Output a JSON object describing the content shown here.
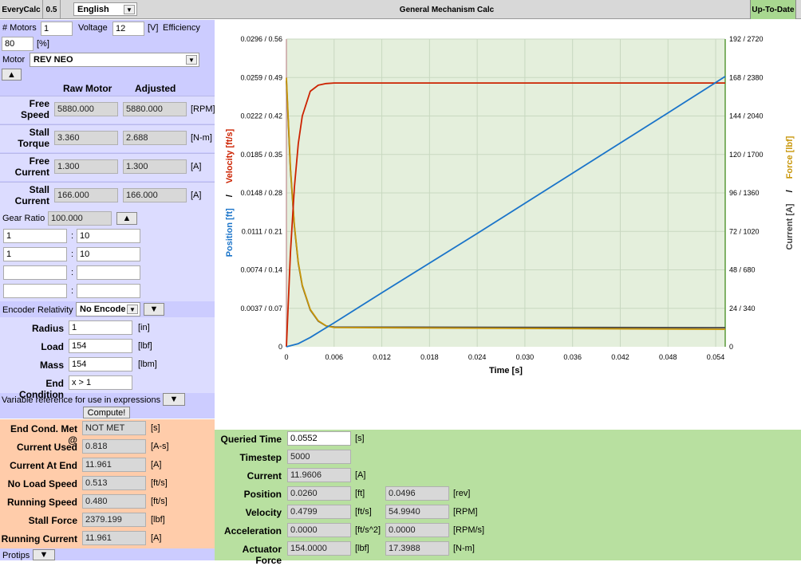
{
  "topbar": {
    "app_name": "EveryCalc",
    "version": "0.5",
    "language": "English",
    "title": "General Mechanism Calc",
    "status": "Up-To-Date"
  },
  "inputs": {
    "motors_label": "# Motors",
    "motors_value": "1",
    "voltage_label": "Voltage",
    "voltage_value": "12",
    "voltage_unit": "[V]",
    "efficiency_label": "Efficiency",
    "efficiency_value": "80",
    "efficiency_unit": "[%]",
    "motor_label": "Motor",
    "motor_value": "REV NEO",
    "collapse_glyph": "▲"
  },
  "motor_table": {
    "col_raw": "Raw Motor",
    "col_adjusted": "Adjusted",
    "rows": [
      {
        "label1": "Free",
        "label2": "Speed",
        "raw": "5880.000",
        "adjusted": "5880.000",
        "unit": "[RPM]"
      },
      {
        "label1": "Stall",
        "label2": "Torque",
        "raw": "3.360",
        "adjusted": "2.688",
        "unit": "[N-m]"
      },
      {
        "label1": "Free",
        "label2": "Current",
        "raw": "1.300",
        "adjusted": "1.300",
        "unit": "[A]"
      },
      {
        "label1": "Stall",
        "label2": "Current",
        "raw": "166.000",
        "adjusted": "166.000",
        "unit": "[A]"
      }
    ]
  },
  "gearing": {
    "label": "Gear Ratio",
    "value": "100.000",
    "collapse_glyph": "▲",
    "stages": [
      {
        "a": "1",
        "b": "10"
      },
      {
        "a": "1",
        "b": "10"
      },
      {
        "a": "",
        "b": ""
      },
      {
        "a": "",
        "b": ""
      }
    ],
    "sep": ":"
  },
  "encoder": {
    "label": "Encoder Relativity",
    "value": "No Encode",
    "expand_glyph": "▼"
  },
  "mechanism": {
    "radius_label": "Radius",
    "radius_value": "1",
    "radius_unit": "[in]",
    "load_label": "Load",
    "load_value": "154",
    "load_unit": "[lbf]",
    "mass_label": "Mass",
    "mass_value": "154",
    "mass_unit": "[lbm]",
    "end_label": "End Condition",
    "end_value": "x > 1",
    "varref_label": "Variable reference for use in expressions",
    "varref_glyph": "▼",
    "compute_label": "Compute!"
  },
  "results": [
    {
      "label": "End Cond. Met @",
      "value": "NOT MET",
      "unit": "[s]"
    },
    {
      "label": "Current Used",
      "value": "0.818",
      "unit": "[A-s]"
    },
    {
      "label": "Current At End",
      "value": "11.961",
      "unit": "[A]"
    },
    {
      "label": "No Load Speed",
      "value": "0.513",
      "unit": "[ft/s]"
    },
    {
      "label": "Running Speed",
      "value": "0.480",
      "unit": "[ft/s]"
    },
    {
      "label": "Stall Force",
      "value": "2379.199",
      "unit": "[lbf]"
    },
    {
      "label": "Running Current",
      "value": "11.961",
      "unit": "[A]"
    }
  ],
  "protips": {
    "label": "Protips",
    "glyph": "▼"
  },
  "query": [
    {
      "label": "Queried Time",
      "v1": "0.0552",
      "u1": "[s]",
      "v2": null,
      "u2": null
    },
    {
      "label": "Timestep",
      "v1": "5000",
      "u1": "",
      "v2": null,
      "u2": null
    },
    {
      "label": "Current",
      "v1": "11.9606",
      "u1": "[A]",
      "v2": null,
      "u2": null
    },
    {
      "label": "Position",
      "v1": "0.0260",
      "u1": "[ft]",
      "v2": "0.0496",
      "u2": "[rev]"
    },
    {
      "label": "Velocity",
      "v1": "0.4799",
      "u1": "[ft/s]",
      "v2": "54.9940",
      "u2": "[RPM]"
    },
    {
      "label": "Acceleration",
      "v1": "0.0000",
      "u1": "[ft/s^2]",
      "v2": "0.0000",
      "u2": "[RPM/s]"
    },
    {
      "label": "Actuator Force",
      "v1": "154.0000",
      "u1": "[lbf]",
      "v2": "17.3988",
      "u2": "[N-m]"
    }
  ],
  "colors": {
    "position": "#1a74c9",
    "velocity": "#cc2200",
    "current": "#444444",
    "force": "#c8960a",
    "plot_bg": "#e4efdc",
    "left_panel": "#ccccff",
    "results_panel": "#ffccaa",
    "query_panel": "#b8e0a0"
  },
  "chart_data": {
    "type": "line",
    "xlabel": "Time [s]",
    "xlim": [
      0,
      0.0552
    ],
    "x_ticks": [
      "0",
      "0.006",
      "0.012",
      "0.018",
      "0.024",
      "0.030",
      "0.036",
      "0.042",
      "0.048",
      "0.054"
    ],
    "left_axis_label_position": "Position [ft]",
    "left_axis_label_sep": "/",
    "left_axis_label_velocity": "Velocity [ft/s]",
    "right_axis_label_current": "Current [A]",
    "right_axis_label_sep": "/",
    "right_axis_label_force": "Force [lbf]",
    "left_ticks": [
      "0",
      "0.0037 / 0.07",
      "0.0074 / 0.14",
      "0.0111 / 0.21",
      "0.0148 / 0.28",
      "0.0185 / 0.35",
      "0.0222 / 0.42",
      "0.0259 / 0.49",
      "0.0296 / 0.56"
    ],
    "right_ticks": [
      "0",
      "24 / 340",
      "48 / 680",
      "72 / 1020",
      "96 / 1360",
      "120 / 1700",
      "144 / 2040",
      "168 / 2380",
      "192 / 2720"
    ],
    "ylim_position": [
      0,
      0.0296
    ],
    "ylim_velocity": [
      0,
      0.56
    ],
    "ylim_current": [
      0,
      192
    ],
    "ylim_force": [
      0,
      2720
    ],
    "series": [
      {
        "name": "Position [ft]",
        "axis": "position",
        "x": [
          0,
          0.0015,
          0.003,
          0.0045,
          0.006,
          0.012,
          0.024,
          0.036,
          0.048,
          0.0552
        ],
        "y": [
          0,
          0.0003,
          0.0009,
          0.0016,
          0.0023,
          0.0052,
          0.0109,
          0.0167,
          0.0225,
          0.026
        ]
      },
      {
        "name": "Velocity [ft/s]",
        "axis": "velocity",
        "x": [
          0,
          0.0005,
          0.001,
          0.0015,
          0.002,
          0.003,
          0.004,
          0.005,
          0.006,
          0.0552
        ],
        "y": [
          0,
          0.17,
          0.29,
          0.37,
          0.42,
          0.465,
          0.476,
          0.479,
          0.48,
          0.48
        ]
      },
      {
        "name": "Current [A]",
        "axis": "current",
        "x": [
          0,
          0.0005,
          0.001,
          0.0015,
          0.002,
          0.003,
          0.004,
          0.005,
          0.006,
          0.0552
        ],
        "y": [
          166,
          111,
          75,
          52,
          38,
          23,
          16,
          13,
          12.3,
          11.96
        ]
      },
      {
        "name": "Force [lbf]",
        "axis": "force",
        "x": [
          0,
          0.0005,
          0.001,
          0.0015,
          0.002,
          0.003,
          0.004,
          0.005,
          0.006,
          0.0552
        ],
        "y": [
          2379,
          1590,
          1075,
          745,
          545,
          330,
          230,
          185,
          170,
          154
        ]
      }
    ]
  }
}
